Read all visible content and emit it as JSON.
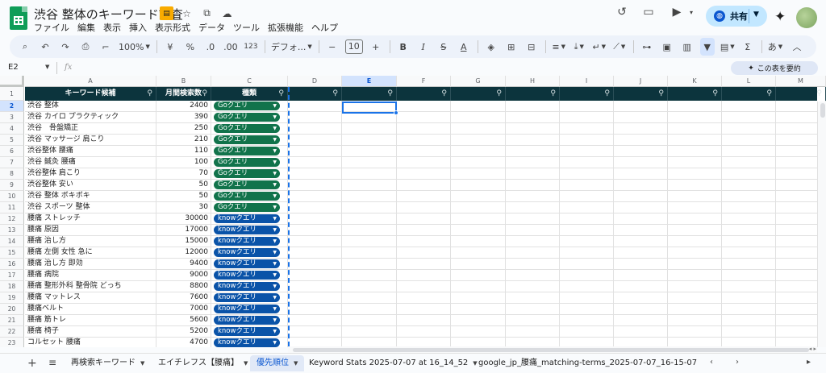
{
  "app": {
    "doc_title": "渋谷 整体のキーワード調査",
    "menu": [
      "ファイル",
      "編集",
      "表示",
      "挿入",
      "表示形式",
      "データ",
      "ツール",
      "拡張機能",
      "ヘルプ"
    ],
    "share_label": "共有"
  },
  "toolbar": {
    "zoom": "100%",
    "currency": "¥",
    "percent": "%",
    "dec_decrease": ".0",
    "dec_increase": ".00",
    "number_format": "123",
    "font": "デフォ...",
    "font_size": "10",
    "input_tool": "あ"
  },
  "formula_bar": {
    "cell_ref": "E2",
    "fx": "fx",
    "summarize_label": "この表を要約"
  },
  "sheet": {
    "column_letters": [
      "A",
      "B",
      "C",
      "D",
      "E",
      "F",
      "G",
      "H",
      "I",
      "J",
      "K",
      "L",
      "M"
    ],
    "header": {
      "row_number": "1",
      "cols": [
        "キーワード候補",
        "月間検索数",
        "種類"
      ]
    },
    "rows": [
      {
        "num": "2",
        "keyword": "渋谷 整体",
        "volume": "2400",
        "type": "Goクエリ",
        "kind": "go"
      },
      {
        "num": "3",
        "keyword": "渋谷 カイロ プラクティック",
        "volume": "390",
        "type": "Goクエリ",
        "kind": "go"
      },
      {
        "num": "4",
        "keyword": "渋谷　骨盤矯正",
        "volume": "250",
        "type": "Goクエリ",
        "kind": "go"
      },
      {
        "num": "5",
        "keyword": "渋谷 マッサージ 肩こり",
        "volume": "210",
        "type": "Goクエリ",
        "kind": "go"
      },
      {
        "num": "6",
        "keyword": "渋谷整体 腰痛",
        "volume": "110",
        "type": "Goクエリ",
        "kind": "go"
      },
      {
        "num": "7",
        "keyword": "渋谷 鍼灸 腰痛",
        "volume": "100",
        "type": "Goクエリ",
        "kind": "go"
      },
      {
        "num": "8",
        "keyword": "渋谷整体 肩こり",
        "volume": "70",
        "type": "Goクエリ",
        "kind": "go"
      },
      {
        "num": "9",
        "keyword": "渋谷整体 安い",
        "volume": "50",
        "type": "Goクエリ",
        "kind": "go"
      },
      {
        "num": "10",
        "keyword": "渋谷 整体 ボキボキ",
        "volume": "50",
        "type": "Goクエリ",
        "kind": "go"
      },
      {
        "num": "11",
        "keyword": "渋谷 スポーツ 整体",
        "volume": "30",
        "type": "Goクエリ",
        "kind": "go"
      },
      {
        "num": "12",
        "keyword": "腰痛 ストレッチ",
        "volume": "30000",
        "type": "knowクエリ",
        "kind": "know"
      },
      {
        "num": "13",
        "keyword": "腰痛 原因",
        "volume": "17000",
        "type": "knowクエリ",
        "kind": "know"
      },
      {
        "num": "14",
        "keyword": "腰痛 治し方",
        "volume": "15000",
        "type": "knowクエリ",
        "kind": "know"
      },
      {
        "num": "15",
        "keyword": "腰痛 左側 女性 急に",
        "volume": "12000",
        "type": "knowクエリ",
        "kind": "know"
      },
      {
        "num": "16",
        "keyword": "腰痛 治し方 即効",
        "volume": "9400",
        "type": "knowクエリ",
        "kind": "know"
      },
      {
        "num": "17",
        "keyword": "腰痛 病院",
        "volume": "9000",
        "type": "knowクエリ",
        "kind": "know"
      },
      {
        "num": "18",
        "keyword": "腰痛 整形外科 整骨院 どっち",
        "volume": "8800",
        "type": "knowクエリ",
        "kind": "know"
      },
      {
        "num": "19",
        "keyword": "腰痛 マットレス",
        "volume": "7600",
        "type": "knowクエリ",
        "kind": "know"
      },
      {
        "num": "20",
        "keyword": "腰痛ベルト",
        "volume": "7000",
        "type": "knowクエリ",
        "kind": "know"
      },
      {
        "num": "21",
        "keyword": "腰痛 筋トレ",
        "volume": "5600",
        "type": "knowクエリ",
        "kind": "know"
      },
      {
        "num": "22",
        "keyword": "腰痛 椅子",
        "volume": "5200",
        "type": "knowクエリ",
        "kind": "know"
      },
      {
        "num": "23",
        "keyword": "コルセット 腰痛",
        "volume": "4700",
        "type": "knowクエリ",
        "kind": "know"
      }
    ],
    "selected_column": "E",
    "selected_row": "2"
  },
  "tabs": [
    {
      "label": "再検索キーワード",
      "active": false
    },
    {
      "label": "エイチレフス【腰痛】",
      "active": false
    },
    {
      "label": "優先順位",
      "active": true
    },
    {
      "label": "Keyword Stats 2025-07-07 at 16_14_52",
      "active": false
    },
    {
      "label": "google_jp_腰痛_matching-terms_2025-07-07_16-15-07",
      "active": false
    }
  ],
  "colors": {
    "header_bg": "#0c343d",
    "go_chip": "#11734b",
    "know_chip": "#0a53a8",
    "accent": "#1a73e8"
  }
}
